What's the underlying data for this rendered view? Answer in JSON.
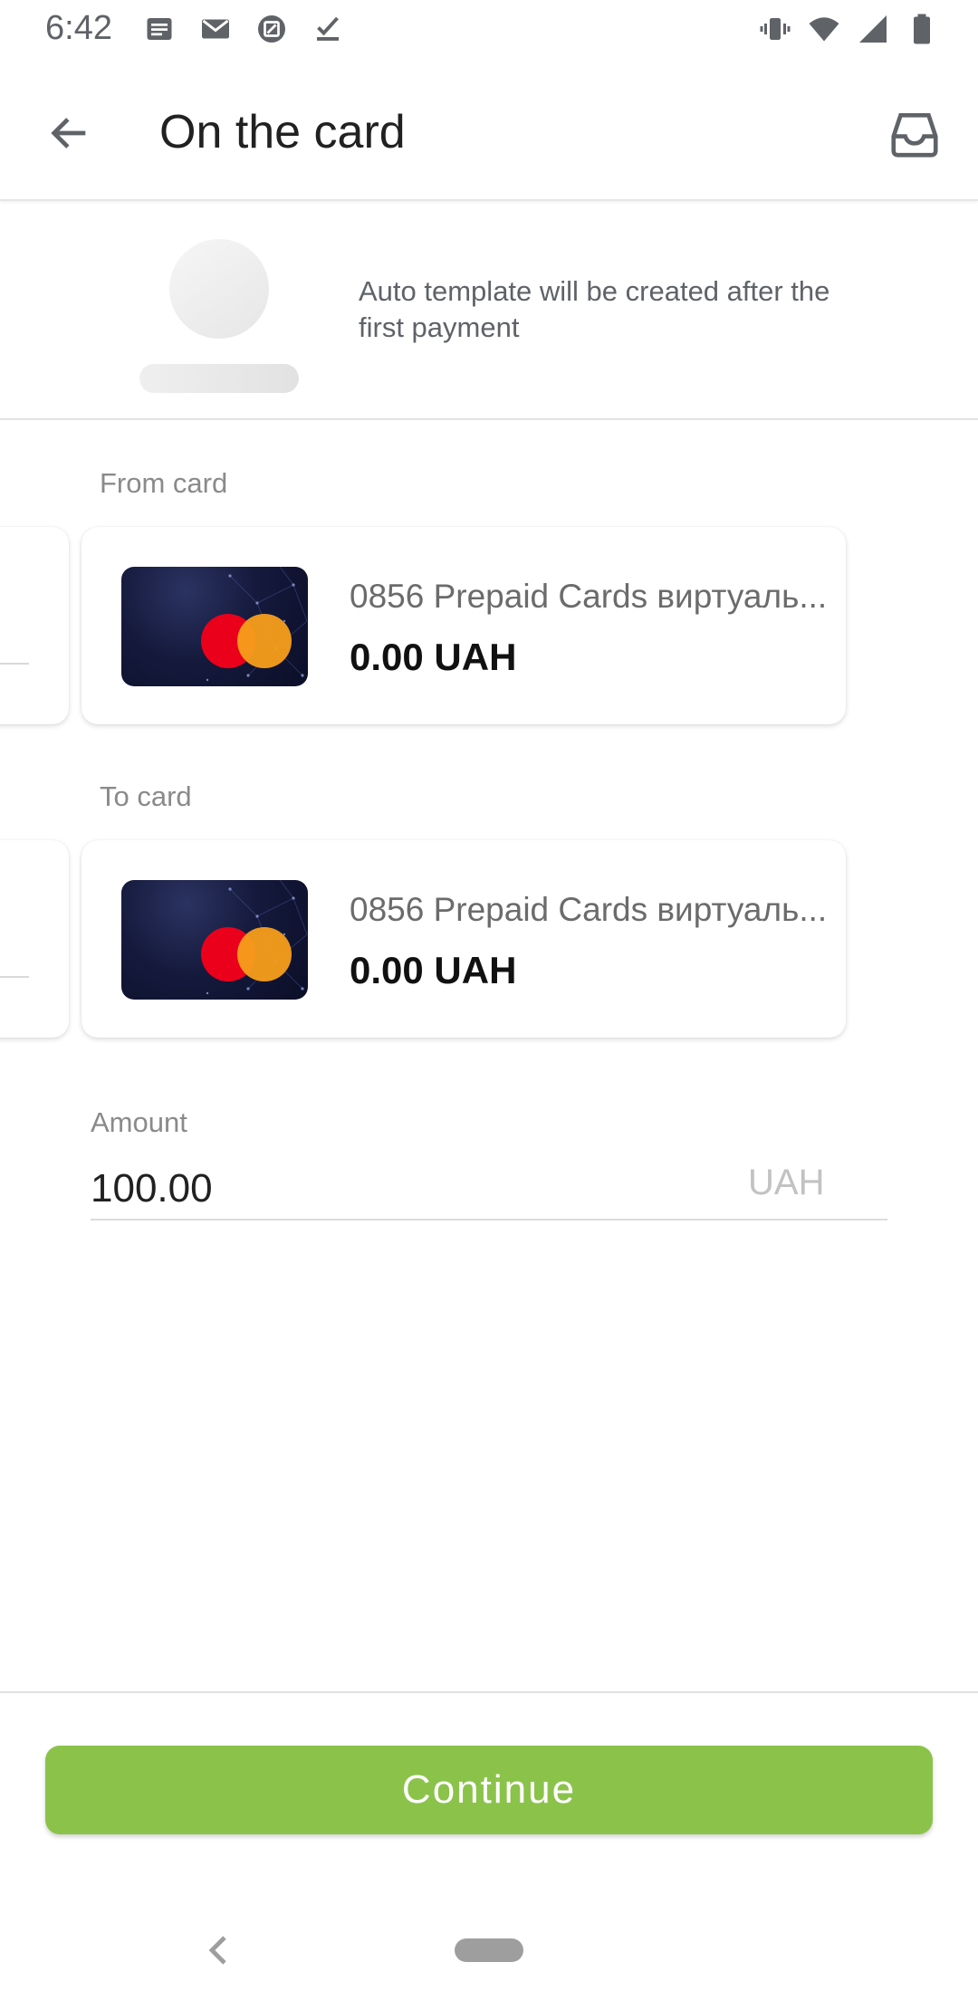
{
  "status_bar": {
    "time": "6:42",
    "left_icons": [
      "news-icon",
      "mail-icon",
      "app-icon",
      "checklist-icon"
    ],
    "right_icons": [
      "vibrate-icon",
      "wifi-icon",
      "signal-icon",
      "battery-icon"
    ]
  },
  "header": {
    "title": "On the card",
    "back_icon": "arrow-left-icon",
    "action_icon": "inbox-icon"
  },
  "template": {
    "info_text": "Auto template will be created after the first payment"
  },
  "from_card": {
    "label": "From card",
    "name": "0856 Prepaid Cards виртуаль...",
    "balance": "0.00 UAH"
  },
  "to_card": {
    "label": "To card",
    "name": "0856 Prepaid Cards виртуаль...",
    "balance": "0.00 UAH"
  },
  "amount": {
    "label": "Amount",
    "value": "100.00",
    "currency": "UAH"
  },
  "actions": {
    "continue_label": "Continue"
  },
  "colors": {
    "accent": "#8bc34a",
    "mastercard_red": "#eb001b",
    "mastercard_orange": "#f79e1b",
    "card_background": "#151a3d"
  }
}
